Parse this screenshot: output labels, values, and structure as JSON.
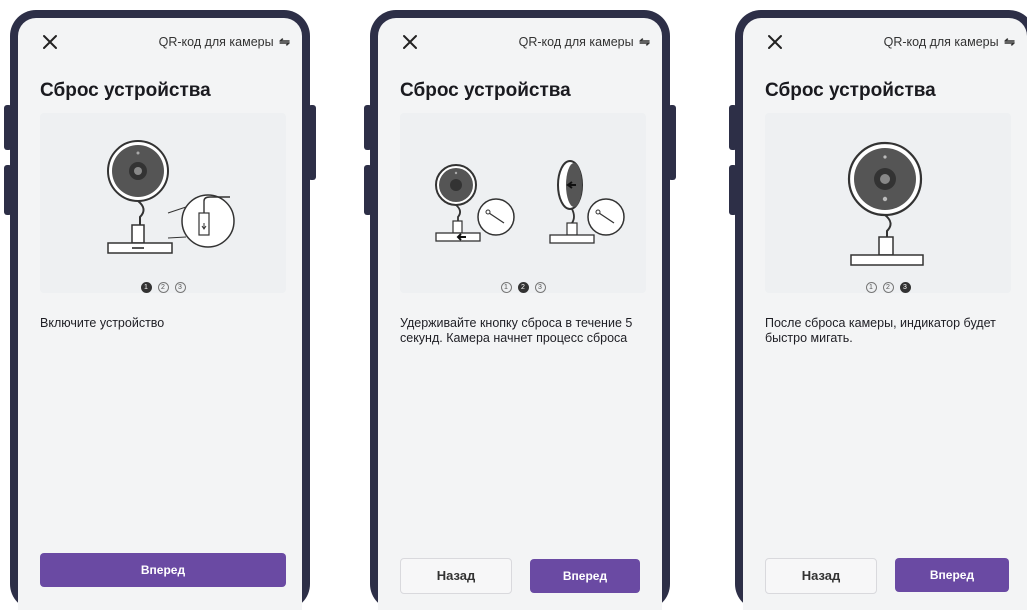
{
  "screens": [
    {
      "header": {
        "close_icon": "close-icon",
        "qr_link": "QR-код для камеры",
        "swap_icon": "⇋"
      },
      "title": "Сброс устройства",
      "pager": [
        "1",
        "2",
        "3"
      ],
      "active_step": 1,
      "description": "Включите устройство",
      "buttons": {
        "next": "Вперед"
      }
    },
    {
      "header": {
        "close_icon": "close-icon",
        "qr_link": "QR-код для камеры",
        "swap_icon": "⇋"
      },
      "title": "Сброс устройства",
      "pager": [
        "1",
        "2",
        "3"
      ],
      "active_step": 2,
      "description": "Удерживайте кнопку сброса в течение 5 секунд. Камера начнет процесс сброса",
      "buttons": {
        "back": "Назад",
        "next": "Вперед"
      }
    },
    {
      "header": {
        "close_icon": "close-icon",
        "qr_link": "QR-код для камеры",
        "swap_icon": "⇋"
      },
      "title": "Сброс устройства",
      "pager": [
        "1",
        "2",
        "3"
      ],
      "active_step": 3,
      "description": "После сброса камеры, индикатор будет быстро мигать.",
      "buttons": {
        "back": "Назад",
        "next": "Вперед"
      }
    }
  ],
  "colors": {
    "primary": "#6a4aa3",
    "frame": "#2d2f47",
    "screen": "#f3f4f5"
  }
}
